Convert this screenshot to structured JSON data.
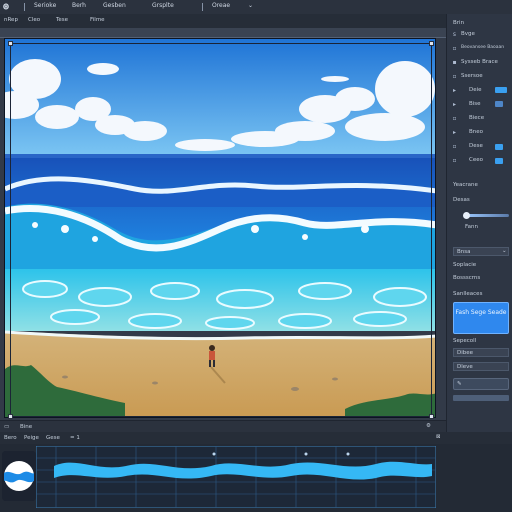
{
  "menubar": {
    "items": [
      "Serioke",
      "Berh",
      "Gesben",
      "Grsplte",
      "Oreae"
    ],
    "separators": 3,
    "chevron_icon": "chevron-down-icon"
  },
  "toolbar": {
    "items": [
      "nRep",
      "Cleo",
      "Tese",
      "Filme"
    ]
  },
  "panel": {
    "top_label": "Brin",
    "rows": [
      {
        "icon": "s",
        "label": "Bvge"
      },
      {
        "icon": "▫",
        "label": "Beovansee Baoaan"
      },
      {
        "icon": "▪",
        "label": "Sysseb Brace"
      },
      {
        "icon": "▫",
        "label": "Ssersoe"
      },
      {
        "icon": "▸",
        "label": "Deie"
      },
      {
        "icon": "▸",
        "label": "Bise"
      },
      {
        "icon": "▫",
        "label": "Biece"
      },
      {
        "icon": "▸",
        "label": "Bneo"
      },
      {
        "icon": "▫",
        "label": "Dese"
      },
      {
        "icon": "▫",
        "label": "Ceeo"
      }
    ],
    "section_label": "Yeacrane",
    "slider_label": "Desas",
    "row_a": "Fann",
    "dropdown_label": "Bnsa",
    "row_b": "Soplacie",
    "row_c": "Bossscrns",
    "section2_label": "Sanlleaces",
    "primary_button": "Fash Sege Seade",
    "row_d": "Sepecoll",
    "row_e": "Dibee",
    "row_f": "Dleve",
    "accent": "#2f88ee"
  },
  "timeline": {
    "header_label": "Bine",
    "tools": [
      "Bero",
      "Peige",
      "Gese"
    ],
    "counter": "= 1",
    "wave_color": "#35b8f5"
  }
}
